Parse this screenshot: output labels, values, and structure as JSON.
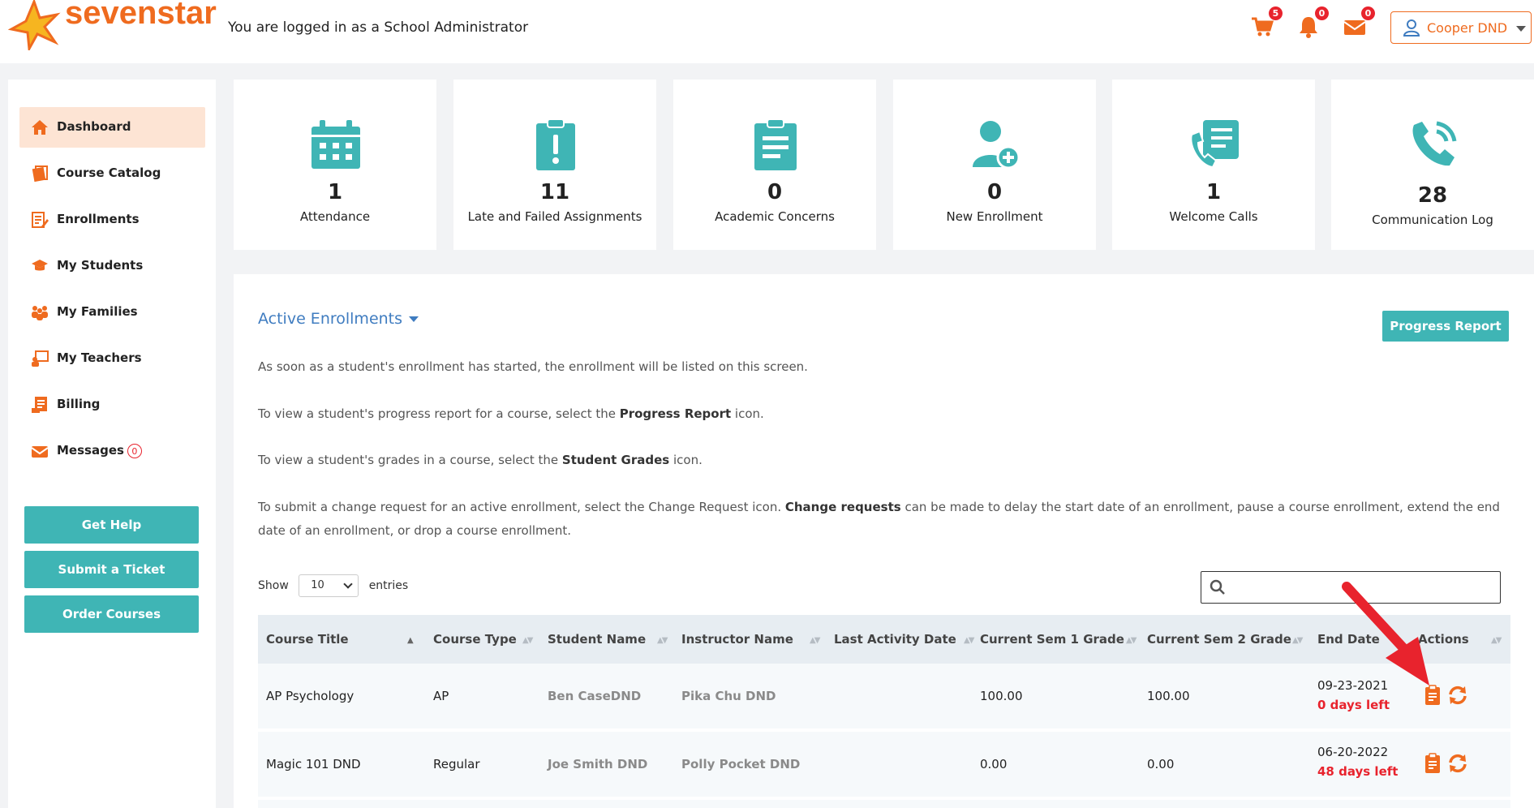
{
  "header": {
    "brand": "sevenstar",
    "login_message": "You are logged in as a School Administrator",
    "cart_count": "5",
    "notifications_count": "0",
    "mail_count": "0",
    "user_name": "Cooper DND"
  },
  "sidebar": {
    "items": [
      {
        "label": "Dashboard",
        "icon": "home-icon"
      },
      {
        "label": "Course Catalog",
        "icon": "catalog-icon"
      },
      {
        "label": "Enrollments",
        "icon": "enrollment-icon"
      },
      {
        "label": "My Students",
        "icon": "graduation-cap-icon"
      },
      {
        "label": "My Families",
        "icon": "family-icon"
      },
      {
        "label": "My Teachers",
        "icon": "teacher-icon"
      },
      {
        "label": "Billing",
        "icon": "billing-icon"
      },
      {
        "label": "Messages",
        "icon": "envelope-icon"
      }
    ],
    "messages_count": "0",
    "buttons": {
      "get_help": "Get Help",
      "submit_ticket": "Submit a Ticket",
      "order_courses": "Order Courses"
    }
  },
  "cards": [
    {
      "value": "1",
      "label": "Attendance",
      "icon": "calendar-icon"
    },
    {
      "value": "11",
      "label": "Late and Failed Assignments",
      "icon": "clipboard-alert-icon"
    },
    {
      "value": "0",
      "label": "Academic Concerns",
      "icon": "clipboard-list-icon"
    },
    {
      "value": "0",
      "label": "New Enrollment",
      "icon": "user-plus-icon"
    },
    {
      "value": "1",
      "label": "Welcome Calls",
      "icon": "phone-list-icon"
    },
    {
      "value": "28",
      "label": "Communication Log",
      "icon": "phone-ring-icon"
    }
  ],
  "main": {
    "title": "Active Enrollments",
    "progress_report_button": "Progress Report",
    "info": {
      "p1": "As soon as a student's enrollment has started, the enrollment will be listed on this screen.",
      "p2a": "To view a student's progress report for a course, select the ",
      "p2b": "Progress Report",
      "p2c": " icon.",
      "p3a": "To view a student's grades in a course, select the ",
      "p3b": "Student Grades",
      "p3c": " icon.",
      "p4a": "To submit a change request for an active enrollment, select the Change Request icon. ",
      "p4b": "Change requests",
      "p4c": " can be made to delay the start date of an enrollment, pause a course enrollment, extend the end date of an enrollment, or drop a course enrollment."
    },
    "show_label": "Show",
    "entries_value": "10",
    "entries_label": "entries",
    "search_placeholder": ""
  },
  "table": {
    "columns": [
      "Course Title",
      "Course Type",
      "Student Name",
      "Instructor Name",
      "Last Activity Date",
      "Current Sem 1 Grade",
      "Current Sem 2 Grade",
      "End Date",
      "Actions"
    ],
    "rows": [
      {
        "course_title": "AP Psychology",
        "course_type": "AP",
        "student_name": "Ben CaseDND",
        "instructor_name": "Pika Chu DND",
        "last_activity": "",
        "sem1": "100.00",
        "sem2": "100.00",
        "end_date": "09-23-2021",
        "days_left": "0 days left"
      },
      {
        "course_title": "Magic 101 DND",
        "course_type": "Regular",
        "student_name": "Joe Smith DND",
        "instructor_name": "Polly Pocket DND",
        "last_activity": "",
        "sem1": "0.00",
        "sem2": "0.00",
        "end_date": "06-20-2022",
        "days_left": "48 days left"
      }
    ]
  },
  "colors": {
    "brand_orange": "#ef6b1f",
    "teal": "#3fb5b5",
    "link_blue": "#3f7cc0",
    "alert_red": "#e8232d"
  }
}
